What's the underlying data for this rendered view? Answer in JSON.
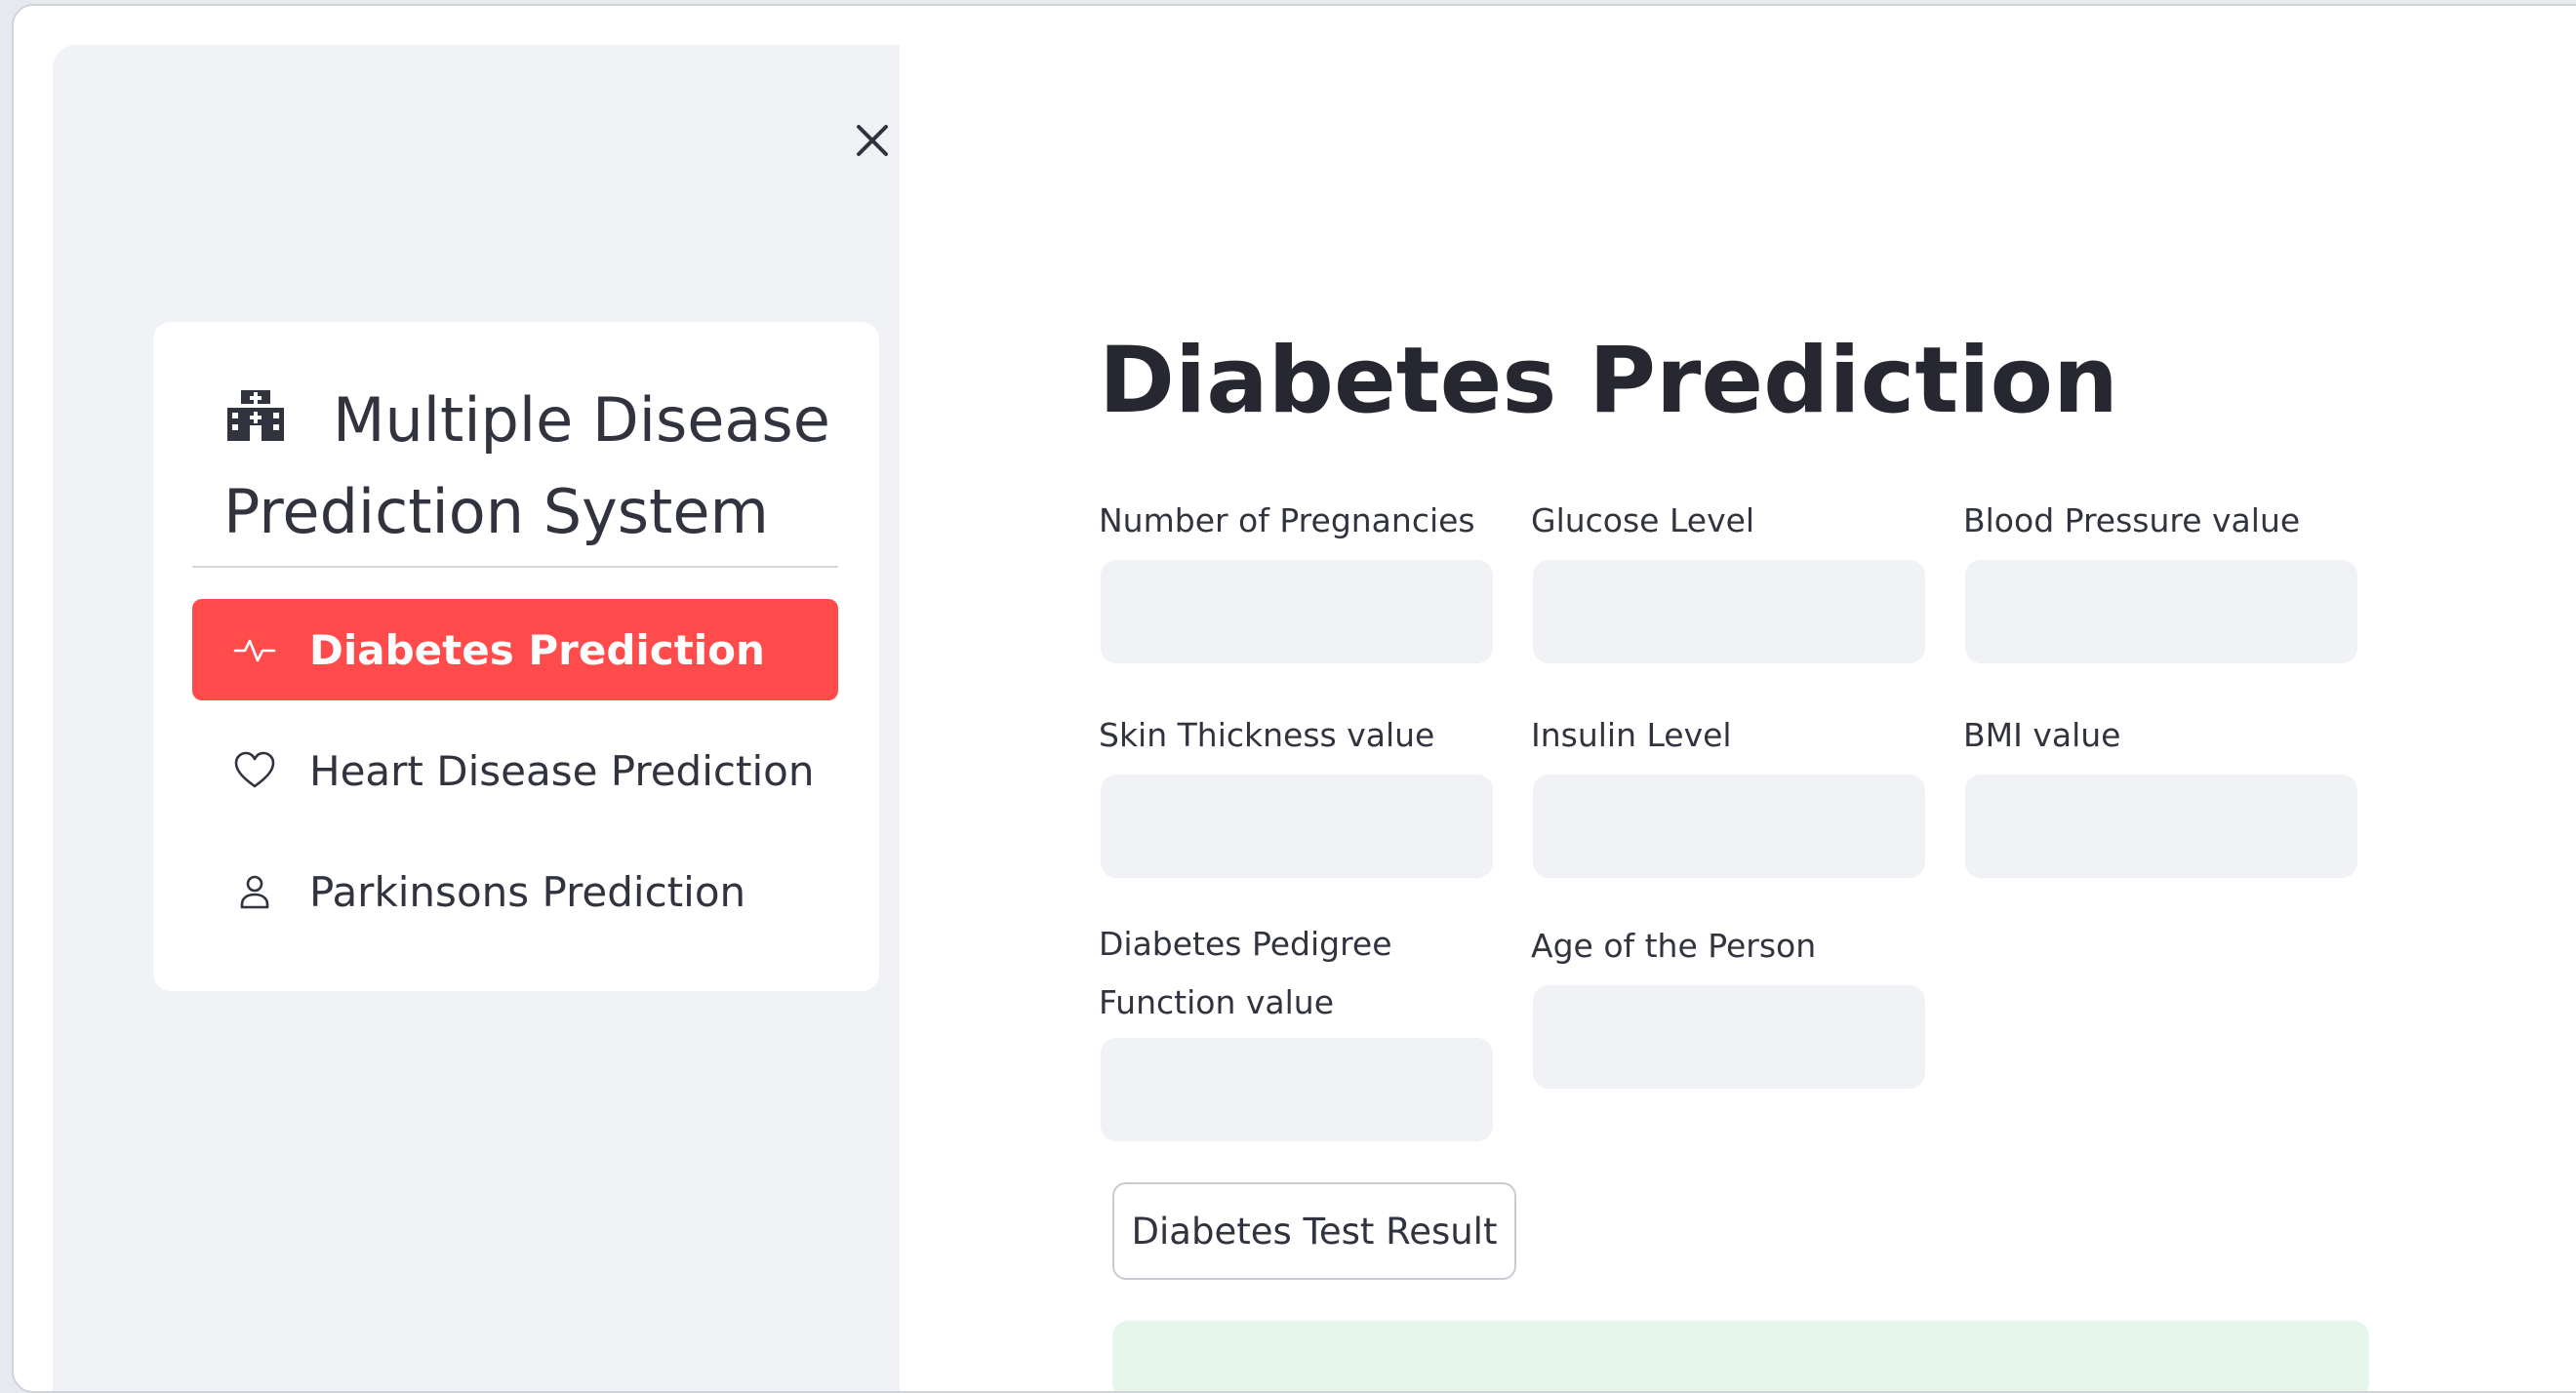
{
  "sidebar": {
    "title": "Multiple Disease Prediction System",
    "title_icon": "hospital-icon",
    "close_icon": "close-icon",
    "menu": [
      {
        "label": "Diabetes Prediction",
        "icon": "activity-icon",
        "active": true
      },
      {
        "label": "Heart Disease Prediction",
        "icon": "heart-icon",
        "active": false
      },
      {
        "label": "Parkinsons Prediction",
        "icon": "person-icon",
        "active": false
      }
    ]
  },
  "main": {
    "title": "Diabetes Prediction",
    "fields": [
      {
        "label": "Number of Pregnancies",
        "value": ""
      },
      {
        "label": "Glucose Level",
        "value": ""
      },
      {
        "label": "Blood Pressure value",
        "value": ""
      },
      {
        "label": "Skin Thickness value",
        "value": ""
      },
      {
        "label": "Insulin Level",
        "value": ""
      },
      {
        "label": "BMI value",
        "value": ""
      },
      {
        "label_line1": "Diabetes Pedigree",
        "label_line2": "Function value",
        "value": ""
      },
      {
        "label": "Age of the Person",
        "value": ""
      }
    ],
    "submit_label": "Diabetes Test Result"
  },
  "colors": {
    "accent": "#ff4b4b",
    "sidebar_bg": "#f0f2f6",
    "input_bg": "#f0f2f6",
    "success_bg": "#e6f6ea",
    "text": "#31333f"
  }
}
